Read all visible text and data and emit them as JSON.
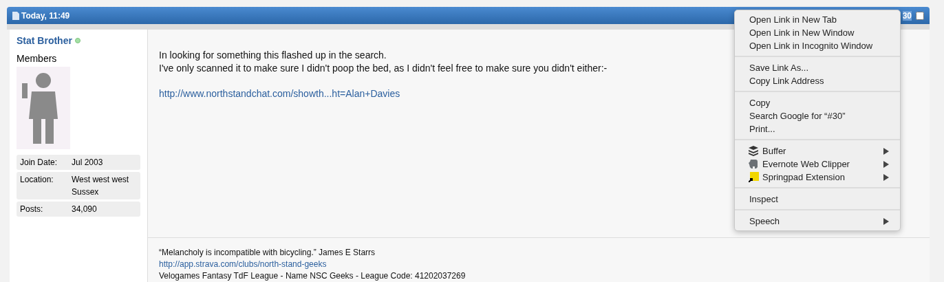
{
  "post_header": {
    "date": "Today, 11:49",
    "post_number": "30",
    "selected_checkbox": false
  },
  "user": {
    "name": "Stat Brother",
    "online": true,
    "title": "Members",
    "details": [
      {
        "label": "Join Date:",
        "value": "Jul 2003"
      },
      {
        "label": "Location:",
        "value": "West west west Sussex"
      },
      {
        "label": "Posts:",
        "value": "34,090"
      }
    ]
  },
  "message": {
    "lines": [
      "In looking for something this flashed up in the search.",
      "I've only scanned it to make sure I didn't poop the bed, as I didn't feel free to make sure you didn't either:-"
    ],
    "link": "http://www.northstandchat.com/showth...ht=Alan+Davies"
  },
  "signature": {
    "quote": "“Melancholy is incompatible with bicycling.” James E Starrs",
    "link": "http://app.strava.com/clubs/north-stand-geeks",
    "league": "Velogames Fantasy TdF League - Name NSC Geeks - League Code: 41202037269"
  },
  "context_menu": {
    "groups": [
      [
        {
          "label": "Open Link in New Tab",
          "kind": "plain",
          "submenu": false
        },
        {
          "label": "Open Link in New Window",
          "kind": "plain",
          "submenu": false
        },
        {
          "label": "Open Link in Incognito Window",
          "kind": "plain",
          "submenu": false
        }
      ],
      [
        {
          "label": "Save Link As...",
          "kind": "plain",
          "submenu": false
        },
        {
          "label": "Copy Link Address",
          "kind": "plain",
          "submenu": false
        }
      ],
      [
        {
          "label": "Copy",
          "kind": "plain",
          "submenu": false
        },
        {
          "label": "Search Google for “#30”",
          "kind": "plain",
          "submenu": false
        },
        {
          "label": "Print...",
          "kind": "plain",
          "submenu": false
        }
      ],
      [
        {
          "label": "Buffer",
          "kind": "layers",
          "submenu": true
        },
        {
          "label": "Evernote Web Clipper",
          "kind": "elephant",
          "submenu": true
        },
        {
          "label": "Springpad Extension",
          "kind": "tile",
          "submenu": true
        }
      ],
      [
        {
          "label": "Inspect",
          "kind": "plain",
          "submenu": false
        }
      ],
      [
        {
          "label": "Speech",
          "kind": "plain",
          "submenu": true
        }
      ]
    ]
  }
}
